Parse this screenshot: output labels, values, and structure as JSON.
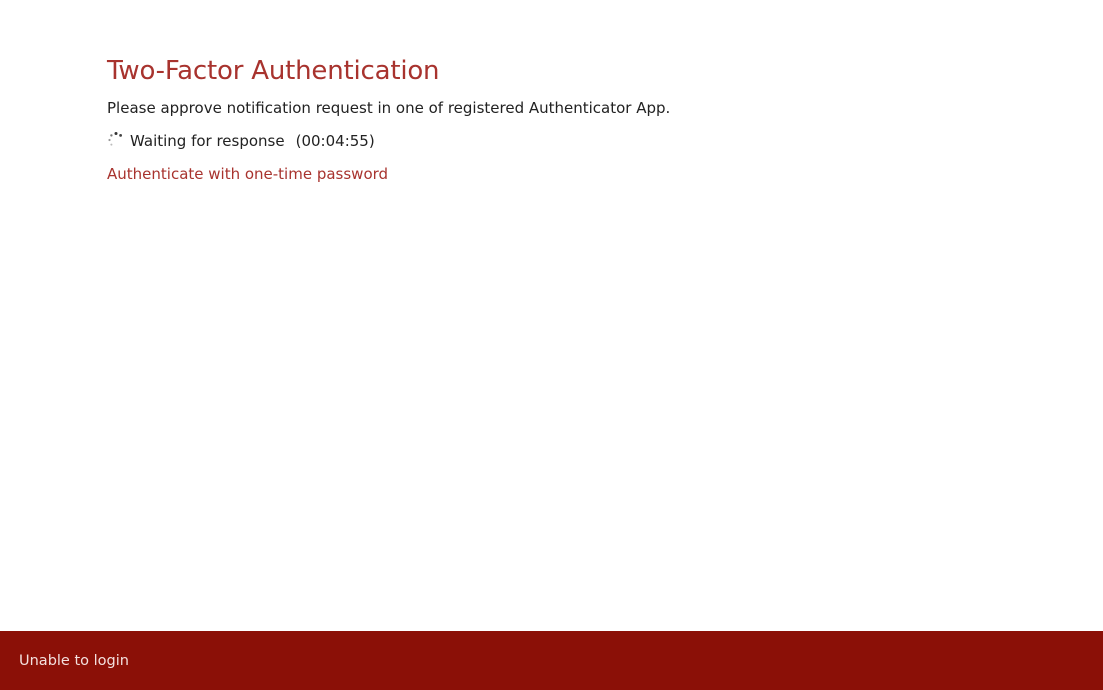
{
  "auth": {
    "title": "Two-Factor Authentication",
    "instruction": "Please approve notification request in one of registered Authenticator App.",
    "waiting_text": "Waiting for response",
    "countdown": "(00:04:55)",
    "spinner_icon": "loading-spinner-icon",
    "otp_link": "Authenticate with one-time password"
  },
  "footer": {
    "unable_to_login": "Unable to login"
  },
  "colors": {
    "accent": "#a8332e",
    "footer_bg": "#8b1007",
    "text": "#222222"
  }
}
